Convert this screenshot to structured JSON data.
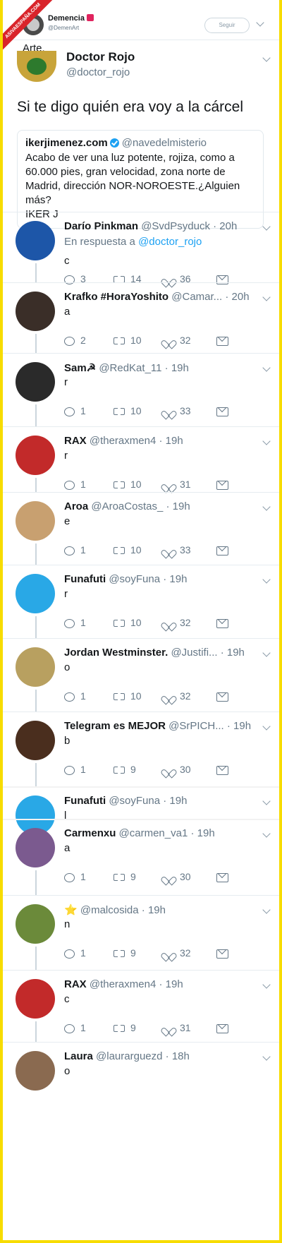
{
  "watermark": "ASIVAESPAÑA.COM",
  "header": {
    "name": "Demencia",
    "handle": "@DemenArt",
    "follow_label": "Seguir"
  },
  "caption": "Arte.",
  "main_tweet": {
    "name": "Doctor Rojo",
    "handle": "@doctor_rojo",
    "text": "Si te digo quién era voy a la cárcel",
    "quote": {
      "name": "ikerjimenez.com",
      "handle": "@navedelmisterio",
      "text": "Acabo de ver una luz potente, rojiza, como a\n60.000 pies, gran velocidad, zona norte de\nMadrid, dirección NOR-NOROESTE.¿Alguien\nmás?\nIKER J"
    }
  },
  "replies": [
    {
      "name": "Darío Pinkman",
      "handle": "@SvdPsyduck",
      "time": "· 20h",
      "reply_to_prefix": "En respuesta a ",
      "reply_to": "@doctor_rojo",
      "text": "c",
      "replies": "3",
      "retweets": "14",
      "likes": "36",
      "avatar_color": "#1d56a8"
    },
    {
      "name": "Krafko #HoraYoshito",
      "handle": "@Camar...",
      "time": "· 20h",
      "text": "a",
      "replies": "2",
      "retweets": "10",
      "likes": "32",
      "avatar_color": "#3a2e28"
    },
    {
      "name": "Sam☭",
      "handle": "@RedKat_11",
      "time": "· 19h",
      "text": "r",
      "replies": "1",
      "retweets": "10",
      "likes": "33",
      "avatar_color": "#2a2a2a"
    },
    {
      "name": "RAX",
      "handle": "@theraxmen4",
      "time": "· 19h",
      "text": "r",
      "replies": "1",
      "retweets": "10",
      "likes": "31",
      "avatar_color": "#c22a2a"
    },
    {
      "name": "Aroa",
      "handle": "@AroaCostas_",
      "time": "· 19h",
      "text": "e",
      "replies": "1",
      "retweets": "10",
      "likes": "33",
      "avatar_color": "#c8a070"
    },
    {
      "name": "Funafuti",
      "handle": "@soyFuna",
      "time": "· 19h",
      "text": "r",
      "replies": "1",
      "retweets": "10",
      "likes": "32",
      "avatar_color": "#29a8e6"
    },
    {
      "name": "Jordan Westminster.",
      "handle": "@Justifi...",
      "time": "· 19h",
      "text": "o",
      "replies": "1",
      "retweets": "10",
      "likes": "32",
      "avatar_color": "#b8a060"
    },
    {
      "name": "Telegram es MEJOR",
      "handle": "@SrPICH...",
      "time": "· 19h",
      "text": "b",
      "replies": "1",
      "retweets": "9",
      "likes": "30",
      "avatar_color": "#4a2e1e"
    },
    {
      "name": "Funafuti",
      "handle": "@soyFuna",
      "time": "· 19h",
      "text": "l",
      "avatar_color": "#29a8e6"
    },
    {
      "name": "Carmenxu",
      "handle": "@carmen_va1",
      "time": "· 19h",
      "text": "a",
      "replies": "1",
      "retweets": "9",
      "likes": "30",
      "avatar_color": "#7b5a8f"
    },
    {
      "name": "⭐",
      "handle": "@malcosida",
      "time": "· 19h",
      "text": "n",
      "replies": "1",
      "retweets": "9",
      "likes": "32",
      "avatar_color": "#6b8a3a"
    },
    {
      "name": "RAX",
      "handle": "@theraxmen4",
      "time": "· 19h",
      "text": "c",
      "replies": "1",
      "retweets": "9",
      "likes": "31",
      "avatar_color": "#c22a2a"
    },
    {
      "name": "Laura",
      "handle": "@laurarguezd",
      "time": "· 18h",
      "text": "o",
      "avatar_color": "#8a6a50"
    }
  ]
}
